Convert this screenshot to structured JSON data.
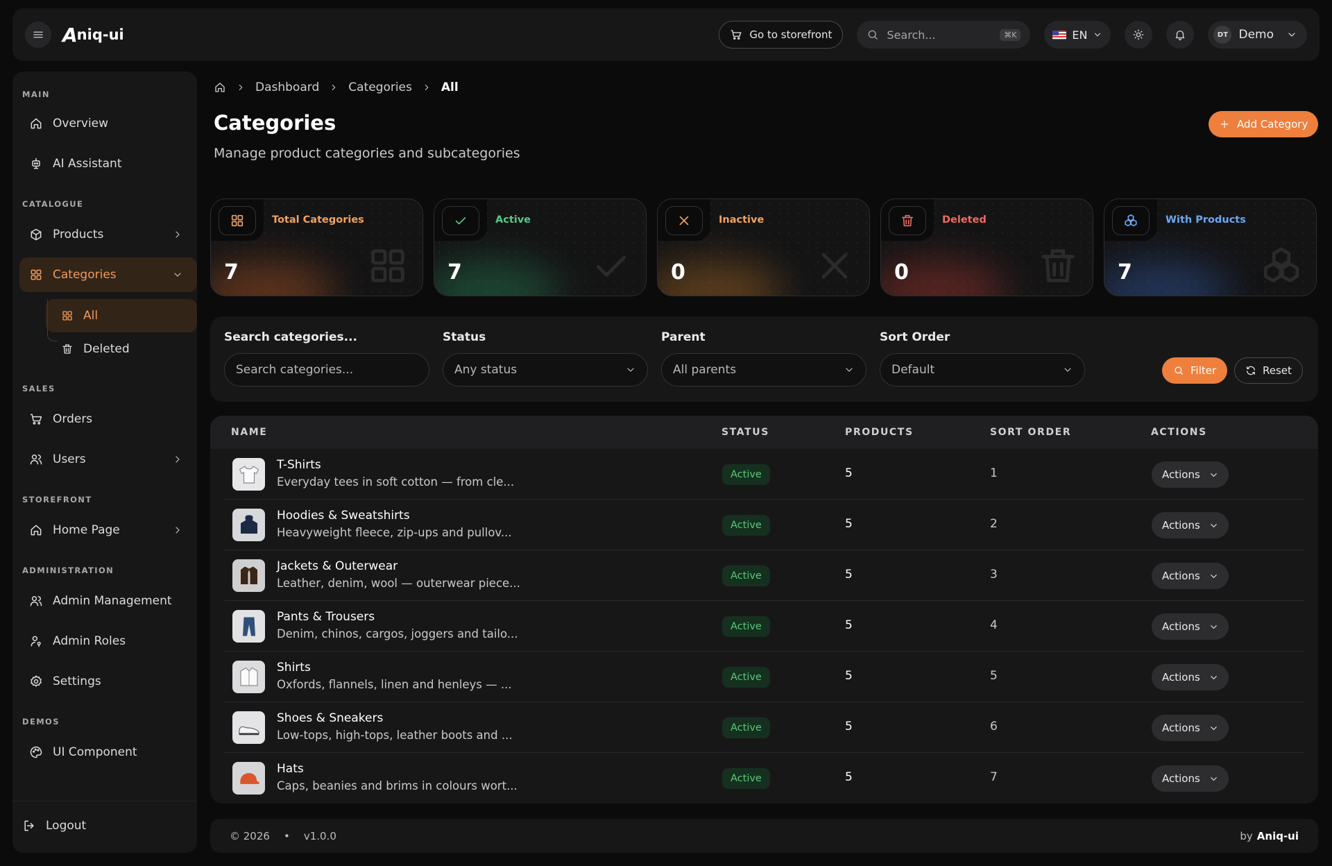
{
  "header": {
    "brand": "niq-ui",
    "brand_mark": "A",
    "storefront_label": "Go to storefront",
    "search_placeholder": "Search...",
    "search_shortcut": "⌘K",
    "language": "EN",
    "user_initials": "DT",
    "user_name": "Demo"
  },
  "sidebar": {
    "sections": {
      "main": "MAIN",
      "catalogue": "CATALOGUE",
      "sales": "SALES",
      "storefront": "STOREFRONT",
      "administration": "ADMINISTRATION",
      "demos": "DEMOS"
    },
    "items": {
      "overview": "Overview",
      "ai_assistant": "AI Assistant",
      "products": "Products",
      "categories": "Categories",
      "categories_all": "All",
      "categories_deleted": "Deleted",
      "orders": "Orders",
      "users": "Users",
      "home_page": "Home Page",
      "admin_management": "Admin Management",
      "admin_roles": "Admin Roles",
      "settings": "Settings",
      "ui_component": "UI Component",
      "logout": "Logout"
    }
  },
  "breadcrumb": [
    "Dashboard",
    "Categories",
    "All"
  ],
  "page": {
    "title": "Categories",
    "subtitle": "Manage product categories and subcategories",
    "add_button": "Add Category"
  },
  "stats": [
    {
      "label": "Total Categories",
      "value": "7",
      "color": "#f0a35f"
    },
    {
      "label": "Active",
      "value": "7",
      "color": "#56c98a"
    },
    {
      "label": "Inactive",
      "value": "0",
      "color": "#f0a35f"
    },
    {
      "label": "Deleted",
      "value": "0",
      "color": "#f06a5f"
    },
    {
      "label": "With Products",
      "value": "7",
      "color": "#6aa7f0"
    }
  ],
  "filters": {
    "search_label": "Search categories...",
    "search_placeholder": "Search categories...",
    "status_label": "Status",
    "status_value": "Any status",
    "parent_label": "Parent",
    "parent_value": "All parents",
    "sort_label": "Sort Order",
    "sort_value": "Default",
    "filter_button": "Filter",
    "reset_button": "Reset"
  },
  "table": {
    "columns": [
      "NAME",
      "STATUS",
      "PRODUCTS",
      "SORT ORDER",
      "ACTIONS"
    ],
    "rows": [
      {
        "name": "T-Shirts",
        "desc": "Everyday tees in soft cotton — from cle...",
        "status": "Active",
        "products": "5",
        "sort": "1",
        "action": "Actions"
      },
      {
        "name": "Hoodies & Sweatshirts",
        "desc": "Heavyweight fleece, zip-ups and pullov...",
        "status": "Active",
        "products": "5",
        "sort": "2",
        "action": "Actions"
      },
      {
        "name": "Jackets & Outerwear",
        "desc": "Leather, denim, wool — outerwear piece...",
        "status": "Active",
        "products": "5",
        "sort": "3",
        "action": "Actions"
      },
      {
        "name": "Pants & Trousers",
        "desc": "Denim, chinos, cargos, joggers and tailo...",
        "status": "Active",
        "products": "5",
        "sort": "4",
        "action": "Actions"
      },
      {
        "name": "Shirts",
        "desc": "Oxfords, flannels, linen and henleys — ...",
        "status": "Active",
        "products": "5",
        "sort": "5",
        "action": "Actions"
      },
      {
        "name": "Shoes & Sneakers",
        "desc": "Low-tops, high-tops, leather boots and ...",
        "status": "Active",
        "products": "5",
        "sort": "6",
        "action": "Actions"
      },
      {
        "name": "Hats",
        "desc": "Caps, beanies and brims in colours wort...",
        "status": "Active",
        "products": "5",
        "sort": "7",
        "action": "Actions"
      }
    ]
  },
  "footer": {
    "copyright": "© 2026",
    "separator": "•",
    "version": "v1.0.0",
    "by_label": "by",
    "by_name": "Aniq-ui"
  }
}
